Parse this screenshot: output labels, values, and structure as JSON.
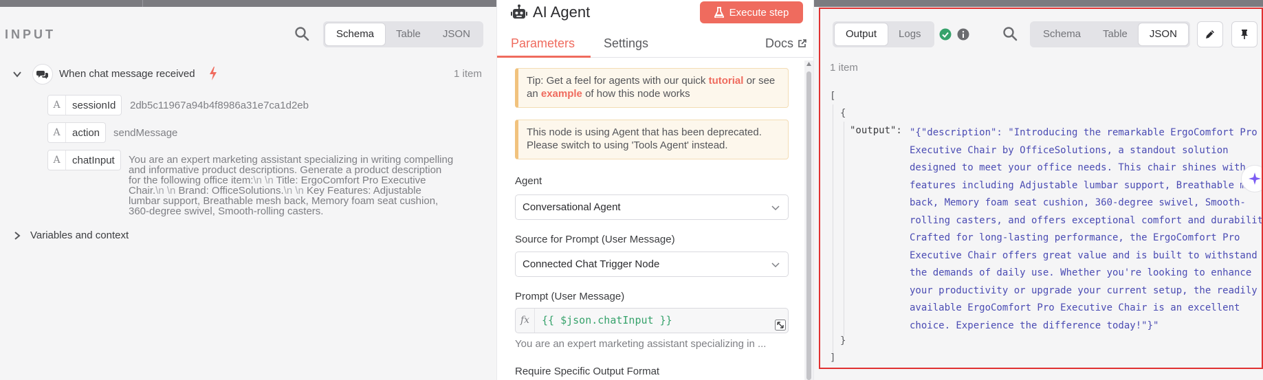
{
  "input_panel": {
    "title": "INPUT",
    "view_tabs": [
      "Schema",
      "Table",
      "JSON"
    ],
    "active_view": "Schema",
    "trigger": {
      "label": "When chat message received",
      "count": "1 item"
    },
    "fields": [
      {
        "name": "sessionId",
        "value": "2db5c11967a94b4f8986a31e7ca1d2eb"
      },
      {
        "name": "action",
        "value": "sendMessage"
      },
      {
        "name": "chatInput",
        "value_lines": [
          [
            "You are an expert marketing assistant specializing in writing compelling"
          ],
          [
            "and informative product descriptions. Generate a product description"
          ],
          [
            "for the following office item:",
            "\\n \\n",
            " Title: ErgoComfort Pro Executive"
          ],
          [
            "Chair.",
            "\\n \\n",
            " Brand: OfficeSolutions.",
            "\\n \\n",
            " Key Features: Adjustable"
          ],
          [
            "lumbar support, Breathable mesh back, Memory foam seat cushion,"
          ],
          [
            "360-degree swivel, Smooth-rolling casters."
          ]
        ]
      }
    ],
    "variables_label": "Variables and context"
  },
  "node_panel": {
    "title": "AI Agent",
    "execute_label": "Execute step",
    "tabs": [
      "Parameters",
      "Settings"
    ],
    "active_tab": "Parameters",
    "docs_label": "Docs",
    "tip": {
      "prefix": "Tip: Get a feel for agents with our quick ",
      "link1": "tutorial",
      "middle": " or see an ",
      "link2": "example",
      "suffix": " of how this node works"
    },
    "deprecation": "This node is using Agent that has been deprecated. Please switch to using 'Tools Agent' instead.",
    "agent": {
      "label": "Agent",
      "value": "Conversational Agent"
    },
    "prompt_source": {
      "label": "Source for Prompt (User Message)",
      "value": "Connected Chat Trigger Node"
    },
    "prompt": {
      "label": "Prompt (User Message)",
      "fx": "fx",
      "expression": "{{ $json.chatInput }}",
      "preview": "You are an expert marketing assistant specializing in ..."
    },
    "next_label": "Require Specific Output Format"
  },
  "output_panel": {
    "tabs": [
      "Output",
      "Logs"
    ],
    "active_tab": "Output",
    "view_tabs": [
      "Schema",
      "Table",
      "JSON"
    ],
    "active_view": "JSON",
    "count": "1 item",
    "json": {
      "open_array": "[",
      "open_obj": "{",
      "key": "\"output\":",
      "value_lines": [
        "\"{\"description\": \"Introducing the remarkable ErgoComfort Pro",
        "Executive Chair by OfficeSolutions, a standout solution",
        "designed to meet your office needs. This chair shines with",
        "features including Adjustable lumbar support, Breathable mes",
        "back, Memory foam seat cushion, 360-degree swivel, Smooth-",
        "rolling casters, and offers exceptional comfort and durability.",
        "Crafted for long-lasting performance, the ErgoComfort Pro",
        "Executive Chair offers great value and is built to withstand",
        "the demands of daily use. Whether you're looking to enhance",
        "your productivity or upgrade your current setup, the readily",
        "available ErgoComfort Pro Executive Chair is an excellent",
        "choice. Experience the difference today!\"}\""
      ],
      "close_obj": "}",
      "close_array": "]"
    }
  },
  "colors": {
    "accent": "#ef6b5e",
    "success": "#36a26b",
    "highlight": "#e03131",
    "json_string": "#4a4bb3"
  }
}
